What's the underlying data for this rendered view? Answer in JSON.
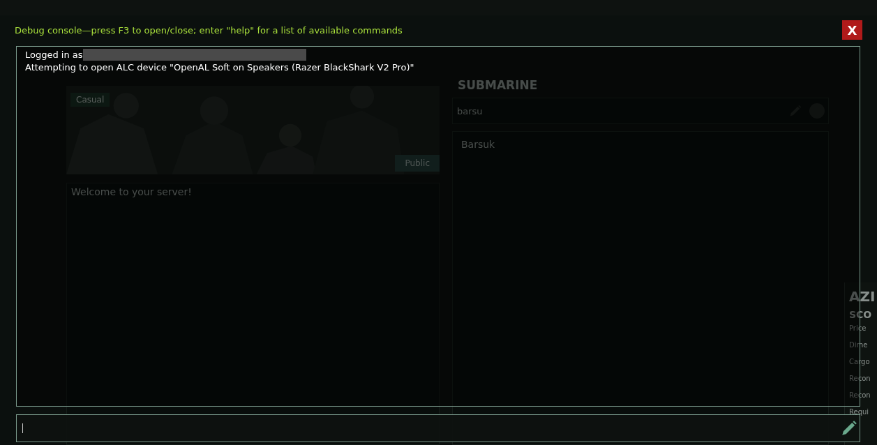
{
  "lobby": {
    "mode_tag": "Casual",
    "visibility_button": "Public",
    "message": "Welcome to your server!",
    "submarine": {
      "heading": "SUBMARINE",
      "search": {
        "value": "barsu"
      },
      "items": [
        {
          "name": "Barsuk"
        }
      ]
    },
    "side_panel": {
      "heading": "AZI",
      "subheading": "SCO",
      "rows": [
        "Price",
        "Dime",
        "Cargo",
        "Recon",
        "Recon",
        "Requi"
      ]
    }
  },
  "console": {
    "title": "Debug console—press F3 to open/close; enter \"help\" for a list of available commands",
    "close_label": "X",
    "lines": [
      {
        "text": "Logged in as",
        "redacted": true
      },
      {
        "text": "Attempting to open ALC device \"OpenAL Soft on Speakers (Razer BlackShark V2 Pro)\"",
        "redacted": false
      }
    ]
  }
}
